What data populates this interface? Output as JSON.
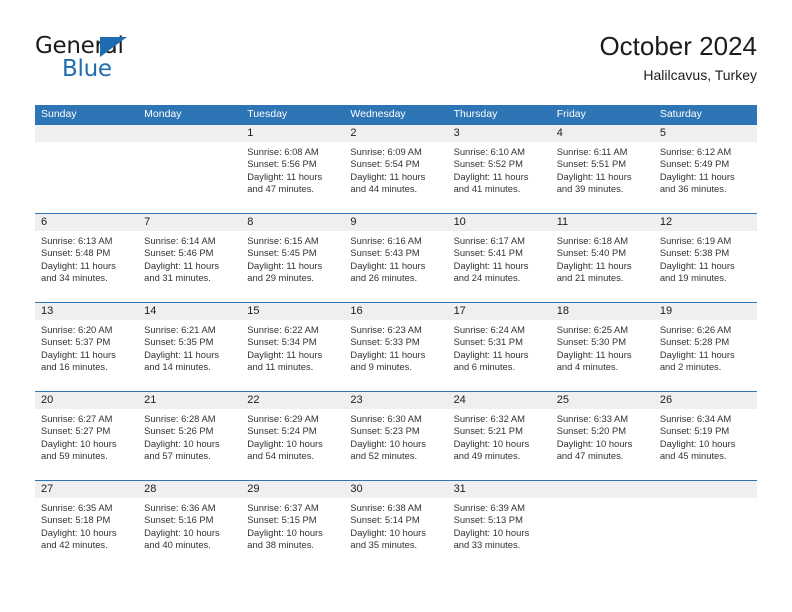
{
  "brand": {
    "word_one": "General",
    "word_two": "Blue",
    "triangle_icon": "blue-triangle-icon",
    "primary_color": "#1f6cb0"
  },
  "header": {
    "title": "October 2024",
    "subtitle": "Halilcavus, Turkey"
  },
  "theme": {
    "header_bar": "#2e75b6",
    "daynum_band": "#efefef",
    "text": "#1c1c1c"
  },
  "calendar": {
    "weekday_headers": [
      "Sunday",
      "Monday",
      "Tuesday",
      "Wednesday",
      "Thursday",
      "Friday",
      "Saturday"
    ],
    "weeks": [
      [
        {
          "day": "",
          "lines": []
        },
        {
          "day": "",
          "lines": []
        },
        {
          "day": "1",
          "lines": [
            "Sunrise: 6:08 AM",
            "Sunset: 5:56 PM",
            "Daylight: 11 hours and 47 minutes."
          ]
        },
        {
          "day": "2",
          "lines": [
            "Sunrise: 6:09 AM",
            "Sunset: 5:54 PM",
            "Daylight: 11 hours and 44 minutes."
          ]
        },
        {
          "day": "3",
          "lines": [
            "Sunrise: 6:10 AM",
            "Sunset: 5:52 PM",
            "Daylight: 11 hours and 41 minutes."
          ]
        },
        {
          "day": "4",
          "lines": [
            "Sunrise: 6:11 AM",
            "Sunset: 5:51 PM",
            "Daylight: 11 hours and 39 minutes."
          ]
        },
        {
          "day": "5",
          "lines": [
            "Sunrise: 6:12 AM",
            "Sunset: 5:49 PM",
            "Daylight: 11 hours and 36 minutes."
          ]
        }
      ],
      [
        {
          "day": "6",
          "lines": [
            "Sunrise: 6:13 AM",
            "Sunset: 5:48 PM",
            "Daylight: 11 hours and 34 minutes."
          ]
        },
        {
          "day": "7",
          "lines": [
            "Sunrise: 6:14 AM",
            "Sunset: 5:46 PM",
            "Daylight: 11 hours and 31 minutes."
          ]
        },
        {
          "day": "8",
          "lines": [
            "Sunrise: 6:15 AM",
            "Sunset: 5:45 PM",
            "Daylight: 11 hours and 29 minutes."
          ]
        },
        {
          "day": "9",
          "lines": [
            "Sunrise: 6:16 AM",
            "Sunset: 5:43 PM",
            "Daylight: 11 hours and 26 minutes."
          ]
        },
        {
          "day": "10",
          "lines": [
            "Sunrise: 6:17 AM",
            "Sunset: 5:41 PM",
            "Daylight: 11 hours and 24 minutes."
          ]
        },
        {
          "day": "11",
          "lines": [
            "Sunrise: 6:18 AM",
            "Sunset: 5:40 PM",
            "Daylight: 11 hours and 21 minutes."
          ]
        },
        {
          "day": "12",
          "lines": [
            "Sunrise: 6:19 AM",
            "Sunset: 5:38 PM",
            "Daylight: 11 hours and 19 minutes."
          ]
        }
      ],
      [
        {
          "day": "13",
          "lines": [
            "Sunrise: 6:20 AM",
            "Sunset: 5:37 PM",
            "Daylight: 11 hours and 16 minutes."
          ]
        },
        {
          "day": "14",
          "lines": [
            "Sunrise: 6:21 AM",
            "Sunset: 5:35 PM",
            "Daylight: 11 hours and 14 minutes."
          ]
        },
        {
          "day": "15",
          "lines": [
            "Sunrise: 6:22 AM",
            "Sunset: 5:34 PM",
            "Daylight: 11 hours and 11 minutes."
          ]
        },
        {
          "day": "16",
          "lines": [
            "Sunrise: 6:23 AM",
            "Sunset: 5:33 PM",
            "Daylight: 11 hours and 9 minutes."
          ]
        },
        {
          "day": "17",
          "lines": [
            "Sunrise: 6:24 AM",
            "Sunset: 5:31 PM",
            "Daylight: 11 hours and 6 minutes."
          ]
        },
        {
          "day": "18",
          "lines": [
            "Sunrise: 6:25 AM",
            "Sunset: 5:30 PM",
            "Daylight: 11 hours and 4 minutes."
          ]
        },
        {
          "day": "19",
          "lines": [
            "Sunrise: 6:26 AM",
            "Sunset: 5:28 PM",
            "Daylight: 11 hours and 2 minutes."
          ]
        }
      ],
      [
        {
          "day": "20",
          "lines": [
            "Sunrise: 6:27 AM",
            "Sunset: 5:27 PM",
            "Daylight: 10 hours and 59 minutes."
          ]
        },
        {
          "day": "21",
          "lines": [
            "Sunrise: 6:28 AM",
            "Sunset: 5:26 PM",
            "Daylight: 10 hours and 57 minutes."
          ]
        },
        {
          "day": "22",
          "lines": [
            "Sunrise: 6:29 AM",
            "Sunset: 5:24 PM",
            "Daylight: 10 hours and 54 minutes."
          ]
        },
        {
          "day": "23",
          "lines": [
            "Sunrise: 6:30 AM",
            "Sunset: 5:23 PM",
            "Daylight: 10 hours and 52 minutes."
          ]
        },
        {
          "day": "24",
          "lines": [
            "Sunrise: 6:32 AM",
            "Sunset: 5:21 PM",
            "Daylight: 10 hours and 49 minutes."
          ]
        },
        {
          "day": "25",
          "lines": [
            "Sunrise: 6:33 AM",
            "Sunset: 5:20 PM",
            "Daylight: 10 hours and 47 minutes."
          ]
        },
        {
          "day": "26",
          "lines": [
            "Sunrise: 6:34 AM",
            "Sunset: 5:19 PM",
            "Daylight: 10 hours and 45 minutes."
          ]
        }
      ],
      [
        {
          "day": "27",
          "lines": [
            "Sunrise: 6:35 AM",
            "Sunset: 5:18 PM",
            "Daylight: 10 hours and 42 minutes."
          ]
        },
        {
          "day": "28",
          "lines": [
            "Sunrise: 6:36 AM",
            "Sunset: 5:16 PM",
            "Daylight: 10 hours and 40 minutes."
          ]
        },
        {
          "day": "29",
          "lines": [
            "Sunrise: 6:37 AM",
            "Sunset: 5:15 PM",
            "Daylight: 10 hours and 38 minutes."
          ]
        },
        {
          "day": "30",
          "lines": [
            "Sunrise: 6:38 AM",
            "Sunset: 5:14 PM",
            "Daylight: 10 hours and 35 minutes."
          ]
        },
        {
          "day": "31",
          "lines": [
            "Sunrise: 6:39 AM",
            "Sunset: 5:13 PM",
            "Daylight: 10 hours and 33 minutes."
          ]
        },
        {
          "day": "",
          "lines": []
        },
        {
          "day": "",
          "lines": []
        }
      ]
    ]
  }
}
